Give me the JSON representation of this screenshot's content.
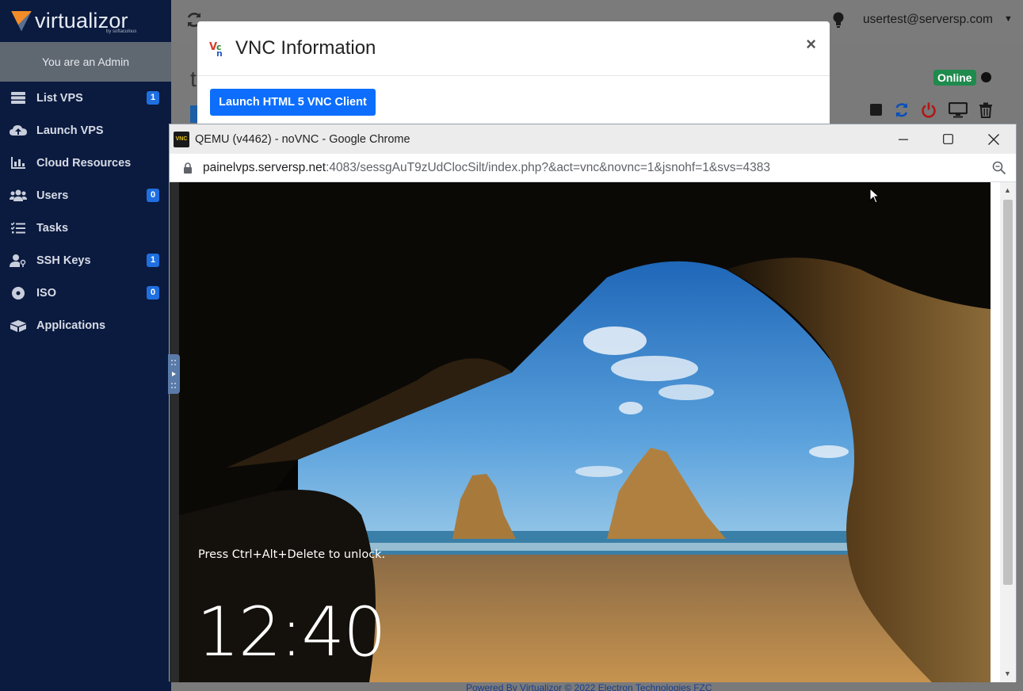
{
  "brand": {
    "name": "virtualizor",
    "sub": "by softaculous"
  },
  "sidebar": {
    "admin_text": "You are an Admin",
    "items": [
      {
        "label": "List VPS",
        "badge": "1",
        "icon": "server-icon"
      },
      {
        "label": "Launch VPS",
        "badge": "",
        "icon": "cloud-upload-icon"
      },
      {
        "label": "Cloud Resources",
        "badge": "",
        "icon": "bar-chart-icon"
      },
      {
        "label": "Users",
        "badge": "0",
        "icon": "users-icon"
      },
      {
        "label": "Tasks",
        "badge": "",
        "icon": "tasks-icon"
      },
      {
        "label": "SSH Keys",
        "badge": "1",
        "icon": "user-key-icon"
      },
      {
        "label": "ISO",
        "badge": "0",
        "icon": "disc-icon"
      },
      {
        "label": "Applications",
        "badge": "",
        "icon": "boxes-icon"
      }
    ]
  },
  "topbar": {
    "user_email": "usertest@serversp.com"
  },
  "page": {
    "title_fragment": "t",
    "status": "Online",
    "footer": "Powered By Virtualizor © 2022 Electron Technologies FZC"
  },
  "modal": {
    "title": "VNC Information",
    "close": "×",
    "launch_button": "Launch HTML 5 VNC Client"
  },
  "chrome": {
    "title": "QEMU (v4462) - noVNC - Google Chrome",
    "favicon_text": "VNC",
    "url_host": "painelvps.serversp.net",
    "url_path": ":4083/sessgAuT9zUdClocSilt/index.php?&act=vnc&novnc=1&jsnohf=1&svs=4383"
  },
  "vnc": {
    "unlock_hint": "Press Ctrl+Alt+Delete to unlock.",
    "time": "12:40"
  },
  "colors": {
    "sidebar_bg": "#0b1a3f",
    "badge": "#1f6fe0",
    "online": "#1e8a4c",
    "primary_button": "#0d6efd"
  }
}
